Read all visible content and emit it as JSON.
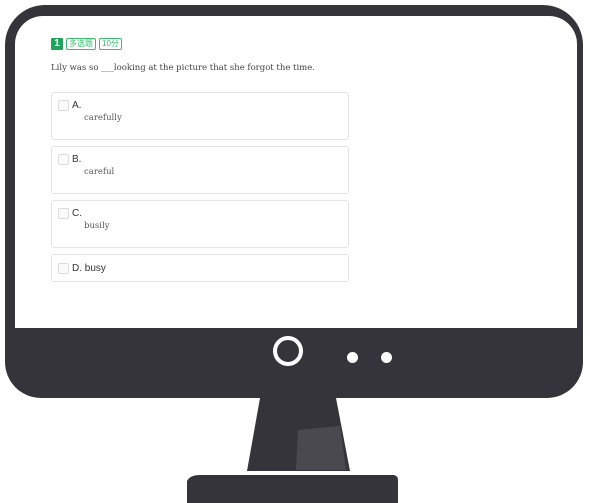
{
  "question": {
    "number": "1",
    "type_tag": "多选题",
    "score_tag": "10分",
    "text": "Lily was so ___looking at the picture that she forgot the time."
  },
  "options": [
    {
      "letter": "A.",
      "value": "carefully"
    },
    {
      "letter": "B.",
      "value": "careful"
    },
    {
      "letter": "C.",
      "value": "busily"
    },
    {
      "letter": "D.",
      "value": "busy",
      "inline_label": "D. busy"
    }
  ],
  "colors": {
    "monitor": "#35343b",
    "accent_green": "#22a45d",
    "tag_green": "#3fb870"
  }
}
